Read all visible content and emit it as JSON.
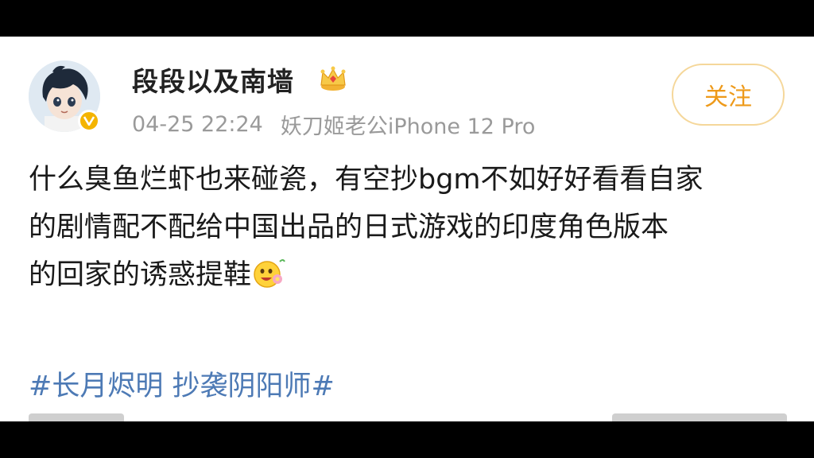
{
  "post": {
    "username": "段段以及南墙",
    "timestamp": "04-25 22:24",
    "source": "妖刀姬老公iPhone 12 Pro",
    "follow_label": "关注",
    "body_line1": "什么臭鱼烂虾也来碰瓷，有空抄bgm不如好好看看自家",
    "body_line2": "的剧情配不配给中国出品的日式游戏的印度角色版本",
    "body_line3": "的回家的诱惑提鞋",
    "hashtag": "#长月烬明 抄袭阴阳师#"
  },
  "icons": {
    "crown": "crown-icon",
    "verified": "verified-v-icon",
    "emoji": "flower-face-emoji-icon"
  },
  "colors": {
    "follow_text": "#ee9a1a",
    "follow_border": "#f5d79a",
    "hashtag": "#4d7ab5",
    "meta": "#9a9a9a",
    "verified": "#f4b400"
  }
}
